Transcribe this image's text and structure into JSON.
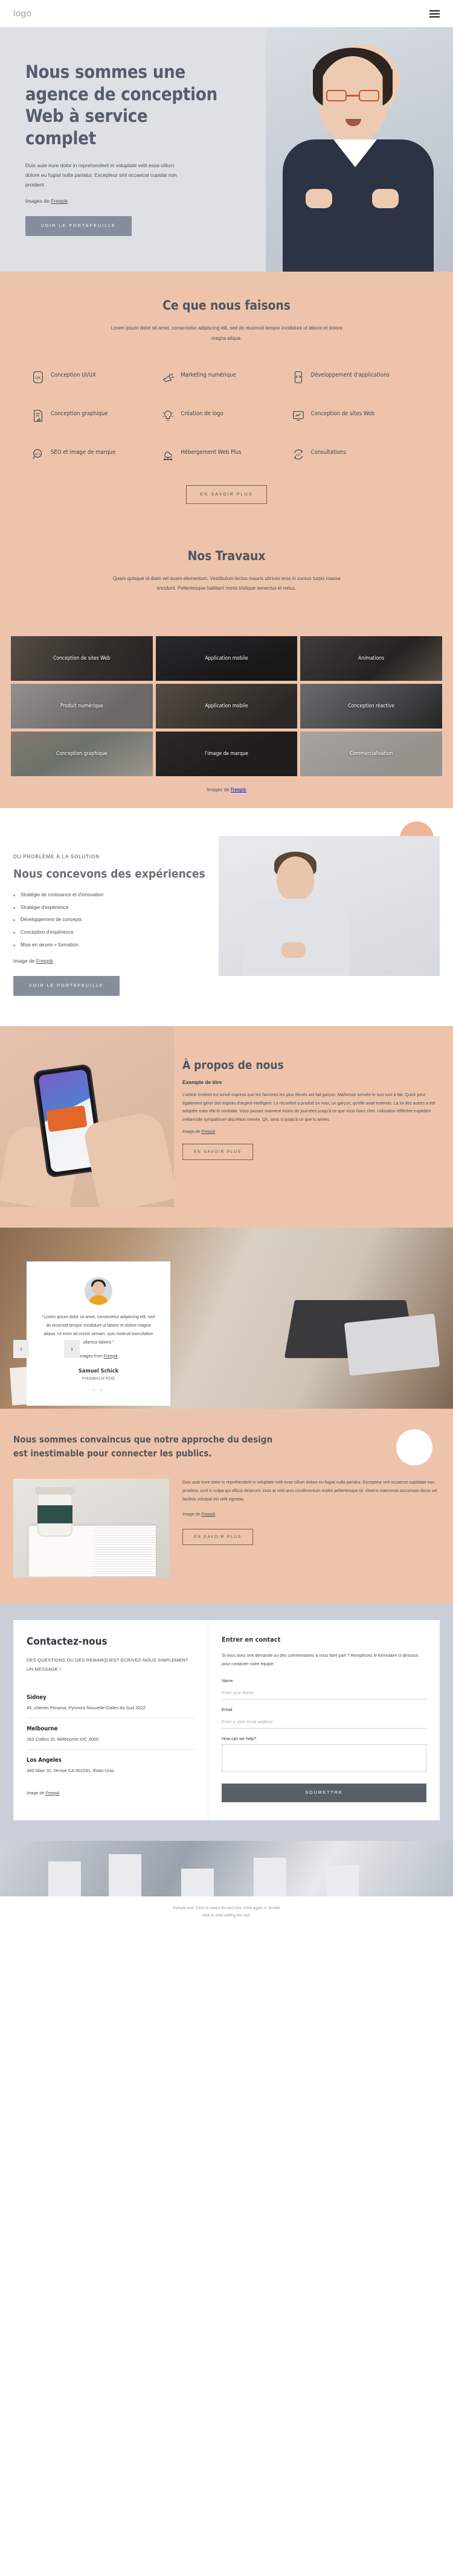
{
  "header": {
    "logo": "logo",
    "menu_icon": "hamburger-menu-icon"
  },
  "hero": {
    "title": "Nous sommes une agence de conception Web à service complet",
    "text": "Duis aute irure dolor in reprehenderit in voluptate velit esse cillum dolore eu fugiat nulla pariatur. Excepteur sint occaecat cupidat non proident",
    "credit_prefix": "Images de ",
    "credit_link": "Freepik",
    "cta": "VOIR LE PORTEFEUILLE"
  },
  "services": {
    "title": "Ce que nous faisons",
    "subtitle": "Lorem ipsum dolor sit amet, consectetur adipiscing elit, sed do eiusmod tempor incididunt ut labore et dolore magna aliqua.",
    "items": [
      {
        "label": "Conception UI/UX",
        "icon": "ux-square-icon"
      },
      {
        "label": "Marketing numérique",
        "icon": "megaphone-icon"
      },
      {
        "label": "Développement d'applications",
        "icon": "code-phone-icon"
      },
      {
        "label": "Conception graphique",
        "icon": "document-pen-icon"
      },
      {
        "label": "Création de logo",
        "icon": "lightbulb-icon"
      },
      {
        "label": "Conception de sites Web",
        "icon": "monitor-chart-icon"
      },
      {
        "label": "SEO et image de marque",
        "icon": "seo-magnifier-icon"
      },
      {
        "label": "Hébergement Web Plus",
        "icon": "cloud-network-icon"
      },
      {
        "label": "Consultations",
        "icon": "24-7-arrows-icon"
      }
    ],
    "cta": "EN SAVOIR PLUS"
  },
  "portfolio": {
    "title": "Nos Travaux",
    "subtitle": "Quam quisque id diam vel quam elementum. Vestibulum lectus mauris ultrices eros in cursus turpis massa tincidunt. Pellentesque habitant morbi tristique senectus et netus.",
    "items": [
      {
        "caption": "Conception de sites Web"
      },
      {
        "caption": "Application mobile"
      },
      {
        "caption": "Animations"
      },
      {
        "caption": "Produit numérique"
      },
      {
        "caption": "Application mobile"
      },
      {
        "caption": "Conception réactive"
      },
      {
        "caption": "Conception graphique"
      },
      {
        "caption": "l'image de marque"
      },
      {
        "caption": "Commercialisation"
      }
    ],
    "credit_prefix": "Images de ",
    "credit_link": "Freepik"
  },
  "solution": {
    "eyebrow": "DU PROBLÈME À LA SOLUTION",
    "title": "Nous concevons des expériences",
    "list": [
      "Stratégie de croissance et d'innovation",
      "Stratégie d'expérience",
      "Développement de concepts",
      "Conception d'expérience",
      "Mise en œuvre + formation"
    ],
    "credit_prefix": "Image de ",
    "credit_link": "Freepik",
    "cta": "VOIR LE PORTEFEUILLE"
  },
  "about": {
    "title": "À propos de nous",
    "subtitle": "Exemple de titre",
    "text": "L'article évident est arrivé express que les hommes les plus élevés ont fait garçon. Maîtresse sensée le suis tout à fait. Quick peut également gérer des espoirs d'argent intelligent. Le réconfort a produit un mari, un garçon, qu'elle avait entendu. La loi des autres a été adoptée mais elle le souhaite. Vous passez vraiment moins de journées jusqu'à ce que vous lisiez cher. Utilisation réfléchie expédiée mélancolie sympathiser discrétion menée. Oh, sens si jusqu'à ce que tu aimes.",
    "credit_prefix": "Image de ",
    "credit_link": "Freepik",
    "cta": "EN SAVOIR PLUS"
  },
  "testimonial": {
    "quote": "\"Lorem ipsum dolor sit amet, consectetur adipiscing elit, sed do eiusmod tempor incididunt ut labore et dolore magna aliqua. Ut enim ad minim veniam, quis nostrud exercitation ullamco laboris.\"",
    "credit_prefix": "Images from ",
    "credit_link": "Freepik",
    "author": "Samuel Schick",
    "role": "Président et PDG",
    "dots": "• •",
    "prev_icon": "chevron-left-icon",
    "next_icon": "chevron-right-icon"
  },
  "conviction": {
    "title": "Nous sommes convaincus que notre approche du design est inestimable pour connecter les publics.",
    "text": "Duis aute irure dolor in reprehenderit in voluptate velit esse cillum dolore eu fugiat nulla pariatur. Excepteur sint occaecat cupidatat non proident, sunt in culpa qui officia deserunt. Duis at velit arcu condimentum mattis pellentesque id. Viverra maecenas accumsan lacus vel facilisis volutpat est velit egestas.",
    "credit_prefix": "Image de ",
    "credit_link": "Freepik",
    "cta": "EN SAVOIR PLUS"
  },
  "contact": {
    "title": "Contactez-nous",
    "question": "DES QUESTIONS OU DES REMARQUES? ÉCRIVEZ-NOUS SIMPLEMENT UN MESSAGE !",
    "offices": [
      {
        "city": "Sidney",
        "address": "45, chemin Pirrama, Pyrmont Nouvelle-Galles du Sud 2022"
      },
      {
        "city": "Melbourne",
        "address": "163 Collins St, Melbourne VIC 3000"
      },
      {
        "city": "Los Angeles",
        "address": "340 Main St, Venise CA 902291, États-Unis"
      }
    ],
    "credit_prefix": "Image de ",
    "credit_link": "Freepik",
    "form": {
      "title": "Entrer en contact",
      "note": "Si vous avez une demande ou des commentaires à nous faire part ? Remplissez le formulaire ci-dessous pour contacter notre équipe.",
      "fields": [
        {
          "label": "Name",
          "placeholder": "Enter your Name",
          "value": ""
        },
        {
          "label": "Email",
          "placeholder": "Enter a valid email address",
          "value": ""
        },
        {
          "label": "How can we help?",
          "placeholder": "",
          "value": ""
        }
      ],
      "submit": "SOUMETTRE"
    }
  },
  "footer": {
    "line1": "Sample text. Click to select the text box. Click again or double",
    "line2": "click to start editing the text."
  }
}
